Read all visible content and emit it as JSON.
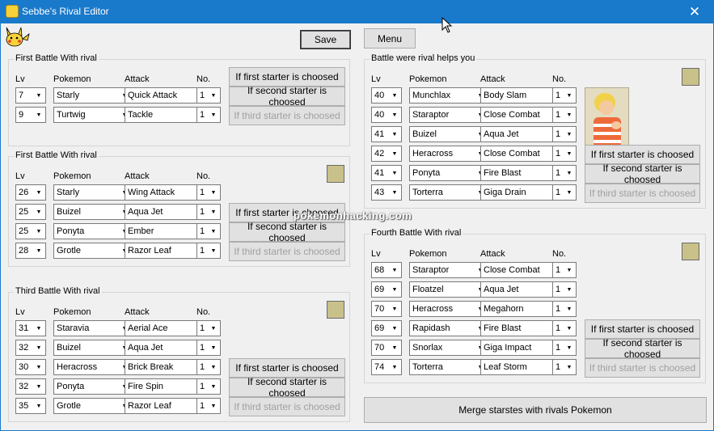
{
  "window": {
    "title": "Sebbe's Rival Editor",
    "close_glyph": "✕"
  },
  "toolbar": {
    "save_label": "Save",
    "menu_label": "Menu"
  },
  "headers": {
    "lv": "Lv",
    "pokemon": "Pokemon",
    "attack": "Attack",
    "no": "No."
  },
  "starter_buttons": {
    "first": "If first starter is choosed",
    "second": "If second starter is choosed",
    "third": "If third starter is choosed"
  },
  "groups": {
    "g1": {
      "title": "First Battle With rival",
      "rows": [
        {
          "lv": "7",
          "pokemon": "Starly",
          "attack": "Quick Attack",
          "no": "1"
        },
        {
          "lv": "9",
          "pokemon": "Turtwig",
          "attack": "Tackle",
          "no": "1"
        }
      ]
    },
    "g2": {
      "title": "First Battle With rival",
      "rows": [
        {
          "lv": "26",
          "pokemon": "Starly",
          "attack": "Wing Attack",
          "no": "1"
        },
        {
          "lv": "25",
          "pokemon": "Buizel",
          "attack": "Aqua Jet",
          "no": "1"
        },
        {
          "lv": "25",
          "pokemon": "Ponyta",
          "attack": "Ember",
          "no": "1"
        },
        {
          "lv": "28",
          "pokemon": "Grotle",
          "attack": "Razor Leaf",
          "no": "1"
        }
      ]
    },
    "g3": {
      "title": "Third Battle With rival",
      "rows": [
        {
          "lv": "31",
          "pokemon": "Staravia",
          "attack": "Aerial Ace",
          "no": "1"
        },
        {
          "lv": "32",
          "pokemon": "Buizel",
          "attack": "Aqua Jet",
          "no": "1"
        },
        {
          "lv": "30",
          "pokemon": "Heracross",
          "attack": "Brick Break",
          "no": "1"
        },
        {
          "lv": "32",
          "pokemon": "Ponyta",
          "attack": "Fire Spin",
          "no": "1"
        },
        {
          "lv": "35",
          "pokemon": "Grotle",
          "attack": "Razor Leaf",
          "no": "1"
        }
      ]
    },
    "g4": {
      "title": "Battle were rival helps you",
      "rows": [
        {
          "lv": "40",
          "pokemon": "Munchlax",
          "attack": "Body Slam",
          "no": "1"
        },
        {
          "lv": "40",
          "pokemon": "Staraptor",
          "attack": "Close Combat",
          "no": "1"
        },
        {
          "lv": "41",
          "pokemon": "Buizel",
          "attack": "Aqua Jet",
          "no": "1"
        },
        {
          "lv": "42",
          "pokemon": "Heracross",
          "attack": "Close Combat",
          "no": "1"
        },
        {
          "lv": "41",
          "pokemon": "Ponyta",
          "attack": "Fire Blast",
          "no": "1"
        },
        {
          "lv": "43",
          "pokemon": "Torterra",
          "attack": "Giga Drain",
          "no": "1"
        }
      ]
    },
    "g5": {
      "title": "Fourth Battle With rival",
      "rows": [
        {
          "lv": "68",
          "pokemon": "Staraptor",
          "attack": "Close Combat",
          "no": "1"
        },
        {
          "lv": "69",
          "pokemon": "Floatzel",
          "attack": "Aqua Jet",
          "no": "1"
        },
        {
          "lv": "70",
          "pokemon": "Heracross",
          "attack": "Megahorn",
          "no": "1"
        },
        {
          "lv": "69",
          "pokemon": "Rapidash",
          "attack": "Fire Blast",
          "no": "1"
        },
        {
          "lv": "70",
          "pokemon": "Snorlax",
          "attack": "Giga Impact",
          "no": "1"
        },
        {
          "lv": "74",
          "pokemon": "Torterra",
          "attack": "Leaf Storm",
          "no": "1"
        }
      ]
    }
  },
  "merge_label": "Merge starstes with rivals Pokemon",
  "watermark": "pokemonhacking.com",
  "colors": {
    "titlebar": "#1979ca",
    "disabled_text": "#a0a0a0",
    "window_bg": "#f0f0f0"
  }
}
